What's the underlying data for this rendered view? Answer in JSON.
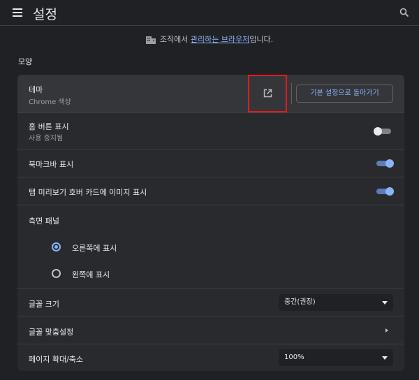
{
  "header": {
    "title": "설정"
  },
  "managed": {
    "prefix": "조직에서 ",
    "link": "관리하는 브라우저",
    "suffix": "입니다."
  },
  "section": {
    "label": "모양"
  },
  "theme": {
    "title": "테마",
    "subtitle": "Chrome 색상",
    "reset_label": "기본 설정으로 돌아가기"
  },
  "home_button": {
    "title": "홈 버튼 표시",
    "subtitle": "사용 중지됨",
    "enabled": false
  },
  "bookmarks_bar": {
    "title": "북마크바 표시",
    "enabled": true
  },
  "tab_hover": {
    "title": "탭 미리보기 호버 카드에 이미지 표시",
    "enabled": true
  },
  "side_panel": {
    "title": "측면 패널",
    "options": [
      {
        "label": "오른쪽에 표시",
        "selected": true
      },
      {
        "label": "왼쪽에 표시",
        "selected": false
      }
    ]
  },
  "font_size": {
    "title": "글꼴 크기",
    "value": "중간(권장)"
  },
  "custom_fonts": {
    "title": "글꼴 맞춤설정"
  },
  "page_zoom": {
    "title": "페이지 확대/축소",
    "value": "100%"
  },
  "colors": {
    "accent": "#8ab4f8",
    "highlight_box": "#e21c1c",
    "background": "#202124",
    "card": "#292a2d"
  },
  "icons": {
    "menu": "menu-icon",
    "search": "search-icon",
    "building": "building-icon",
    "external_link": "open-in-new-icon",
    "chevron": "chevron-right-icon"
  }
}
